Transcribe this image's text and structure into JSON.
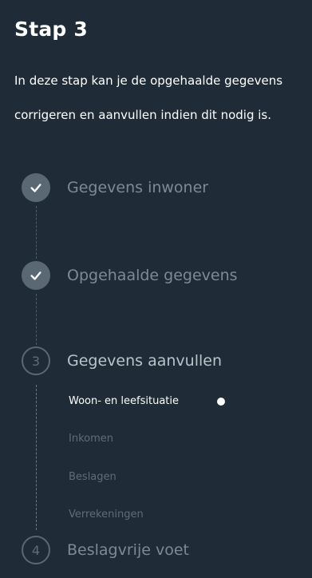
{
  "header": {
    "title": "Stap 3",
    "intro_line1": "In deze stap kan je de opgehaalde gegevens",
    "intro_line2": "corrigeren en aanvullen indien dit nodig is."
  },
  "steps": [
    {
      "number": "",
      "label": "Gegevens inwoner",
      "status": "completed",
      "icon": "check-icon"
    },
    {
      "number": "",
      "label": "Opgehaalde gegevens",
      "status": "completed",
      "icon": "check-icon"
    },
    {
      "number": "3",
      "label": "Gegevens aanvullen",
      "status": "current"
    },
    {
      "number": "4",
      "label": "Beslagvrije voet",
      "status": "upcoming"
    }
  ],
  "substeps": [
    {
      "label": "Woon- en leefsituatie",
      "active": true
    },
    {
      "label": "Inkomen",
      "active": false
    },
    {
      "label": "Beslagen",
      "active": false
    },
    {
      "label": "Verrekeningen",
      "active": false
    }
  ],
  "colors": {
    "background": "#1f2c37",
    "muted": "#5a6873",
    "active_text": "#ffffff"
  }
}
